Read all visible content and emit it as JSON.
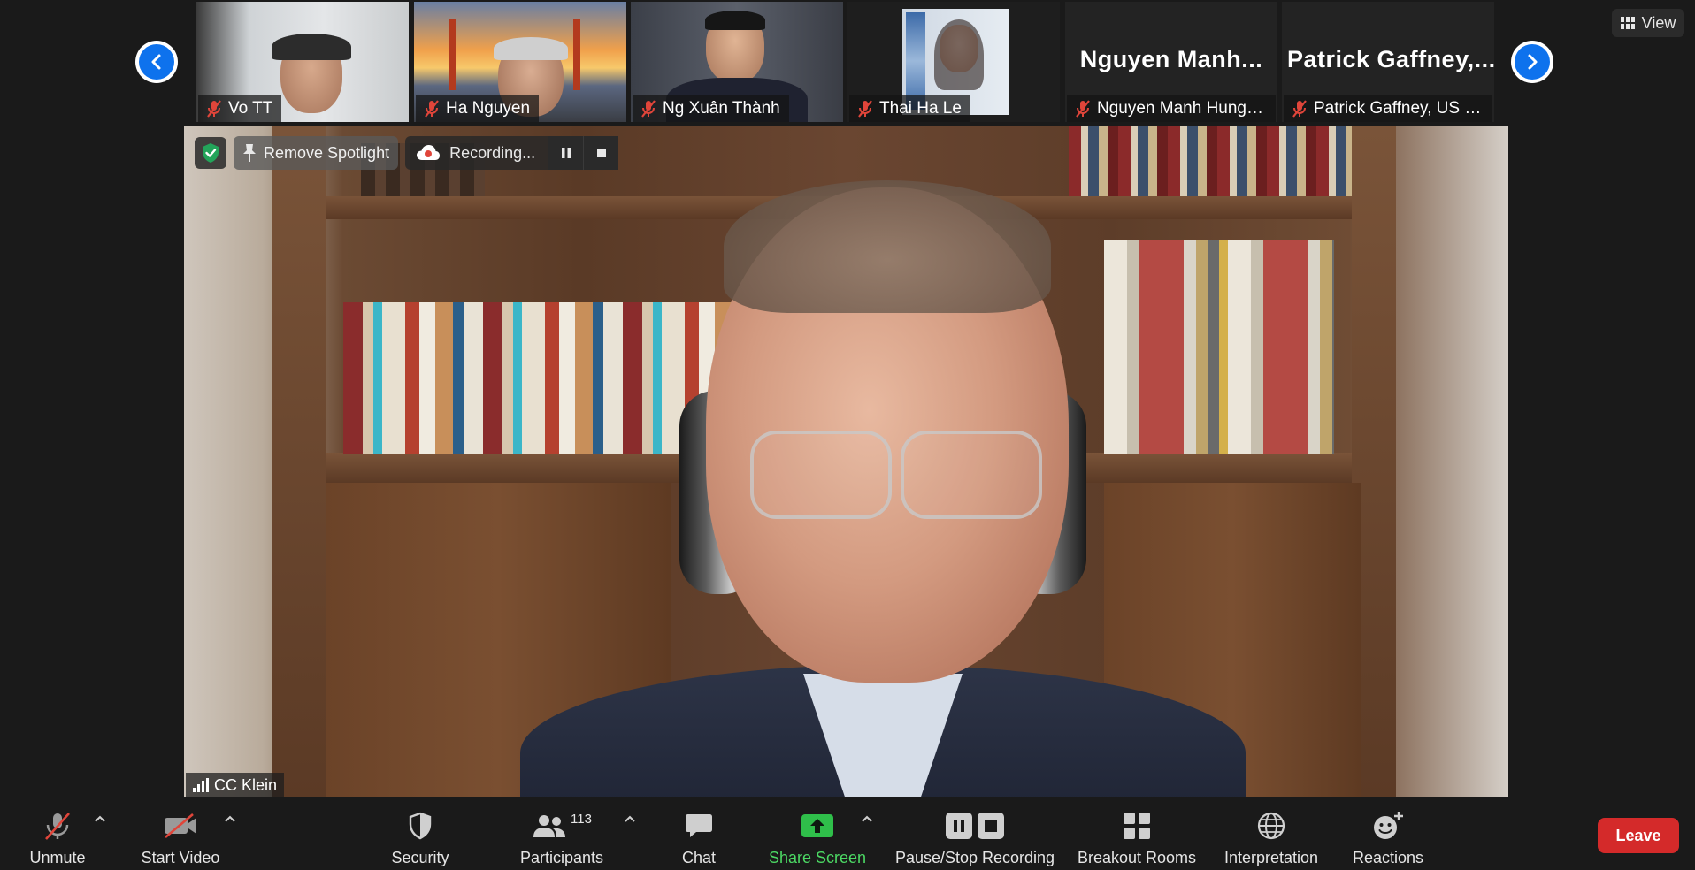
{
  "colors": {
    "accent_blue": "#0e72ed",
    "leave_red": "#d42a2a",
    "share_green": "#4cd964",
    "background": "#1a1a1a",
    "muted_red": "#e0453a"
  },
  "strip": {
    "prev_icon": "chevron-left-icon",
    "next_icon": "chevron-right-icon",
    "participants": [
      {
        "caption": "Vo TT",
        "muted": true,
        "video": true
      },
      {
        "caption": "Ha Nguyen",
        "muted": true,
        "video": true
      },
      {
        "caption": "Ng Xuân Thành",
        "muted": true,
        "video": true
      },
      {
        "caption": "Thai Ha Le",
        "muted": true,
        "video": true
      },
      {
        "caption": "Nguyen Manh Hung _ ...",
        "display_name": "Nguyen  Manh...",
        "muted": true,
        "video": false
      },
      {
        "caption": "Patrick Gaffney, US Co...",
        "display_name": "Patrick  Gaffney,...",
        "muted": true,
        "video": false
      }
    ]
  },
  "view_button": {
    "label": "View",
    "icon": "grid-icon"
  },
  "main": {
    "speaker": "CC Klein",
    "remove_spotlight": "Remove Spotlight",
    "recording_label": "Recording...",
    "secure_icon": "shield-check-icon"
  },
  "toolbar": {
    "unmute": "Unmute",
    "start_video": "Start Video",
    "security": "Security",
    "participants": "Participants",
    "participants_count": "113",
    "chat": "Chat",
    "share_screen": "Share Screen",
    "pause_stop_recording": "Pause/Stop Recording",
    "breakout_rooms": "Breakout Rooms",
    "interpretation": "Interpretation",
    "reactions": "Reactions",
    "leave": "Leave"
  }
}
